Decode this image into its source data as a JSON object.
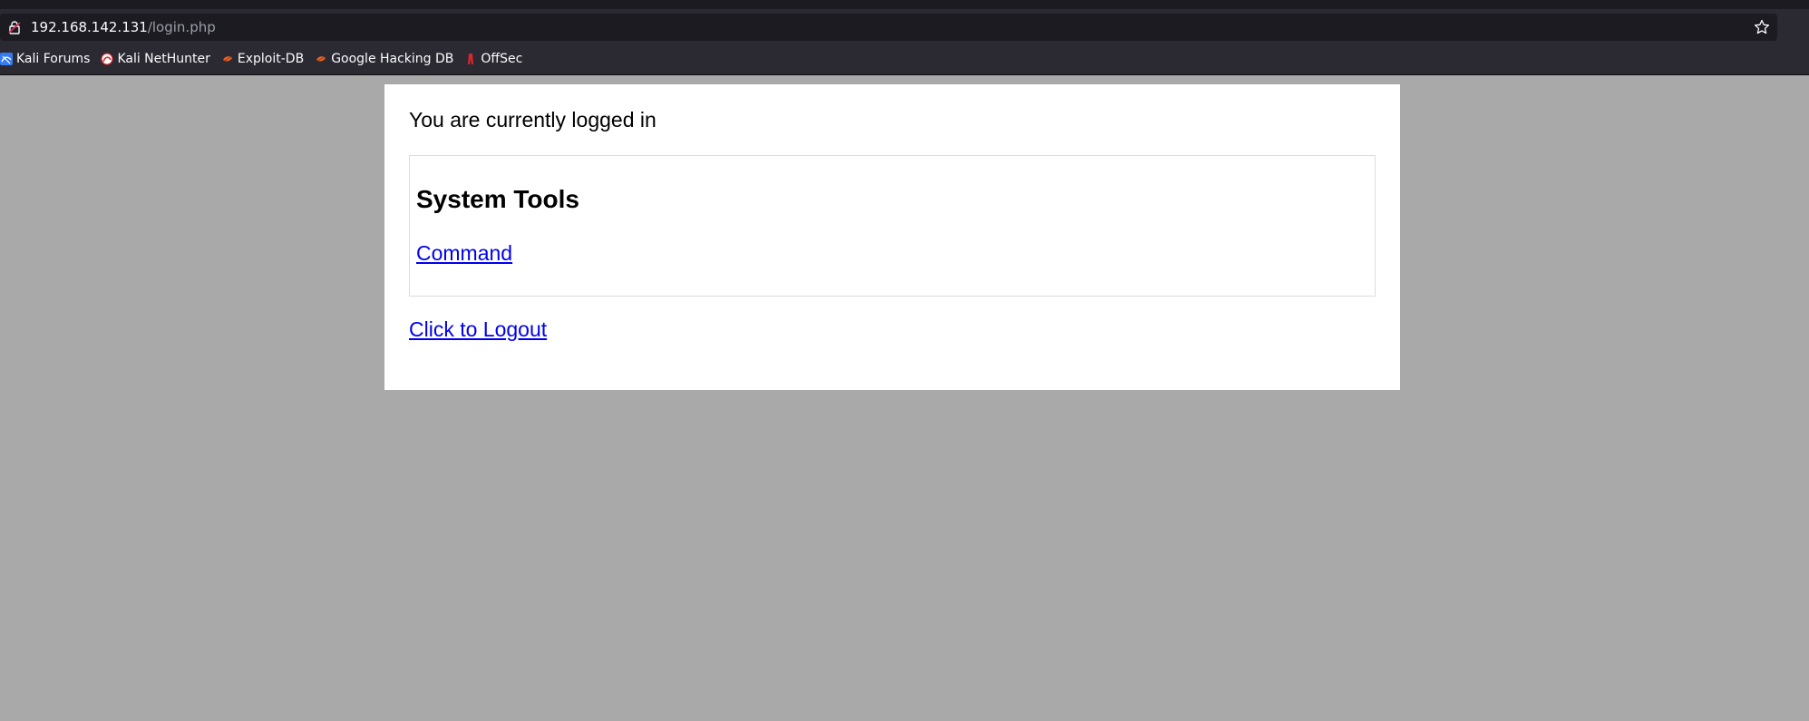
{
  "browser": {
    "url_host": "192.168.142.131",
    "url_path": "/login.php",
    "bookmarks": [
      {
        "label": "Kali Forums",
        "icon": "kali-dragon-icon"
      },
      {
        "label": "Kali NetHunter",
        "icon": "nethunter-icon"
      },
      {
        "label": "Exploit-DB",
        "icon": "exploit-db-icon"
      },
      {
        "label": "Google Hacking DB",
        "icon": "ghdb-icon"
      },
      {
        "label": "OffSec",
        "icon": "offsec-icon"
      }
    ],
    "colors": {
      "chrome_bg": "#2b2a33",
      "urlbar_bg": "#1c1b22",
      "text": "#fbfbfe"
    }
  },
  "page": {
    "status_text": "You are currently logged in",
    "tools_section": {
      "title": "System Tools",
      "command_link": "Command"
    },
    "logout_link": "Click to Logout",
    "colors": {
      "background": "#a9a9a9",
      "panel": "#ffffff",
      "link": "#0000ee"
    }
  }
}
